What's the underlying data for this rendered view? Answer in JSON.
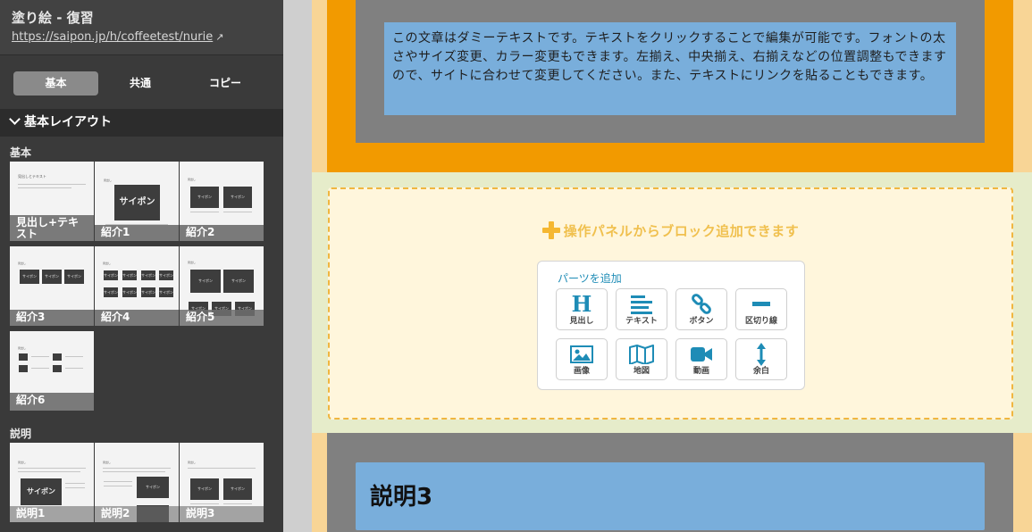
{
  "app": {
    "title": "塗り絵 - 復習",
    "url": "https://saipon.jp/h/coffeetest/nurie"
  },
  "tabs": [
    {
      "label": "基本",
      "active": true
    },
    {
      "label": "共通",
      "active": false
    },
    {
      "label": "コピー",
      "active": false
    }
  ],
  "section": {
    "header": "基本レイアウト",
    "categories": [
      {
        "label": "基本"
      },
      {
        "label": "説明"
      }
    ],
    "layouts_basic": [
      {
        "label": "見出し+テキスト"
      },
      {
        "label": "紹介1"
      },
      {
        "label": "紹介2"
      },
      {
        "label": "紹介3"
      },
      {
        "label": "紹介4"
      },
      {
        "label": "紹介5"
      },
      {
        "label": "紹介6"
      }
    ],
    "layouts_desc": [
      {
        "label": "説明1"
      },
      {
        "label": "説明2"
      },
      {
        "label": "説明3"
      }
    ],
    "thumb_text": "サイポン"
  },
  "canvas": {
    "dummy_text": "この文章はダミーテキストです。テキストをクリックすることで編集が可能です。フォントの太さやサイズ変更、カラー変更もできます。左揃え、中央揃え、右揃えなどの位置調整もできますので、サイトに合わせて変更してください。また、テキストにリンクを貼ることもできます。",
    "add_block_msg": "操作パネルからブロック追加できます",
    "parts_title": "パーツを追加",
    "parts": [
      {
        "label": "見出し",
        "icon": "heading-icon"
      },
      {
        "label": "テキスト",
        "icon": "text-lines-icon"
      },
      {
        "label": "ボタン",
        "icon": "link-icon"
      },
      {
        "label": "区切り線",
        "icon": "divider-icon"
      },
      {
        "label": "画像",
        "icon": "image-icon"
      },
      {
        "label": "地図",
        "icon": "map-icon"
      },
      {
        "label": "動画",
        "icon": "video-icon"
      },
      {
        "label": "余白",
        "icon": "spacing-icon"
      }
    ],
    "next_heading": "説明3"
  },
  "colors": {
    "accent_blue": "#1e8cb6",
    "orange": "#f29a00",
    "text_block": "#79aedb",
    "add_yellow": "#f5b731"
  }
}
